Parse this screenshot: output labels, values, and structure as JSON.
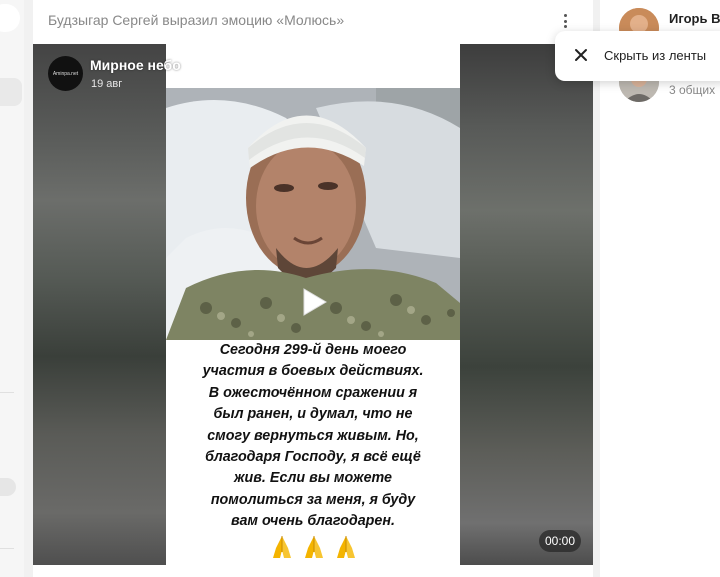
{
  "post": {
    "header": "Будзыгар Сергей выразил эмоцию «Молюсь»",
    "source_name": "Мирное небо",
    "source_date": "19 авг",
    "source_avatar_text": "Aminрa.net",
    "video": {
      "duration": "00:00",
      "caption_lines": [
        "Сегодня 299-й день моего",
        "участия в боевых действиях.",
        "В ожесточённом сражении я",
        "был ранен, и думал, что не",
        "смогу вернуться живым. Но,",
        "благодаря Господу, я всё ещё",
        "жив. Если вы можете",
        "помолиться за меня, я буду",
        "вам очень благодарен."
      ],
      "emoji": "🙏🙏🙏"
    }
  },
  "context_menu": {
    "hide_label": "Скрыть из ленты"
  },
  "right_panel": {
    "person_name": "Игорь В",
    "mutual_friends": "3 общих"
  },
  "icons": {
    "menu": "kebab-icon",
    "close": "close-icon",
    "play": "play-icon",
    "pray": "folded-hands-icon"
  }
}
